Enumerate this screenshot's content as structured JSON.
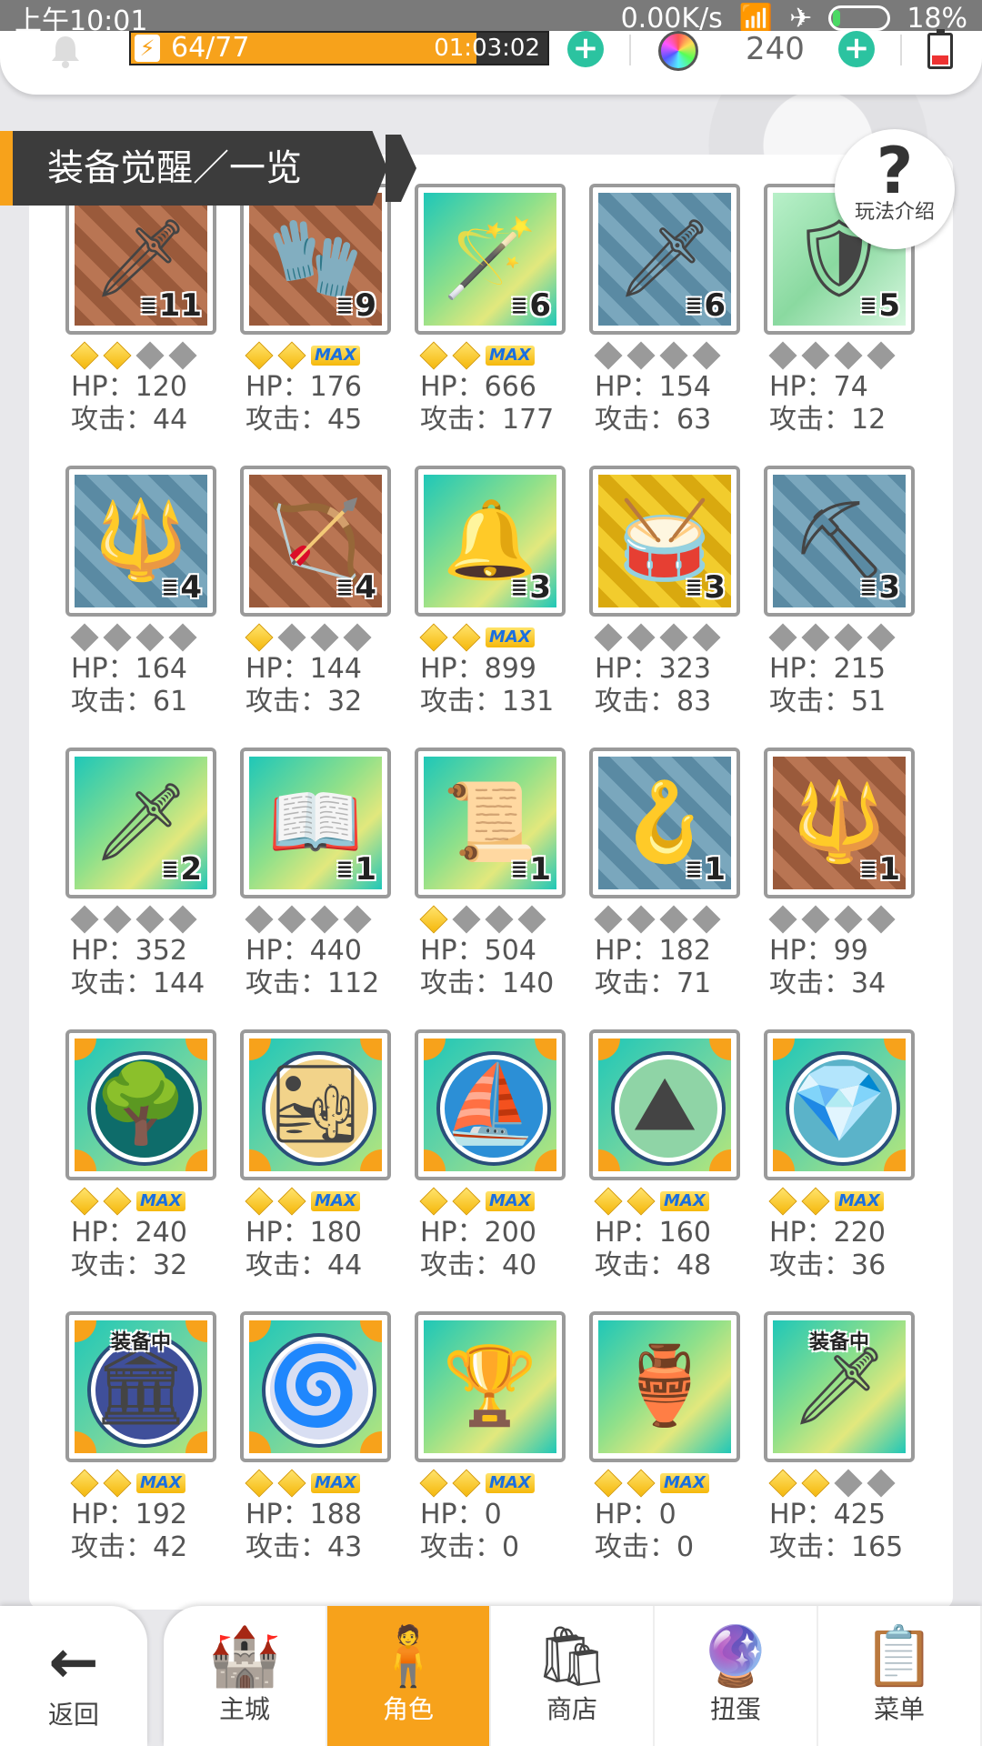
{
  "status_bar": {
    "time": "上午10:01",
    "speed": "0.00K/s",
    "battery": "18%"
  },
  "top_bar": {
    "stamina": "64/77",
    "stamina_fraction": 0.83,
    "timer": "01:03:02",
    "gems": "240"
  },
  "header": {
    "title": "装备觉醒／一览"
  },
  "help": {
    "label": "玩法介绍"
  },
  "stat_labels": {
    "hp": "HP：",
    "atk": "攻击："
  },
  "equipped_label": "装备中",
  "max_label": "MAX",
  "items": [
    {
      "icon": "sword-icon",
      "glyph": "🗡",
      "bg": "brown",
      "count": "11",
      "gold": 2,
      "max": false,
      "hp": "120",
      "atk": "44"
    },
    {
      "icon": "gauntlet-icon",
      "glyph": "🧤",
      "bg": "brown",
      "count": "9",
      "gold": 2,
      "max": true,
      "hp": "176",
      "atk": "45"
    },
    {
      "icon": "staff-icon",
      "glyph": "🪄",
      "bg": "rainbow",
      "count": "6",
      "gold": 2,
      "max": true,
      "hp": "666",
      "atk": "177"
    },
    {
      "icon": "blade-icon",
      "glyph": "🗡",
      "bg": "blue",
      "count": "6",
      "gold": 0,
      "max": false,
      "hp": "154",
      "atk": "63"
    },
    {
      "icon": "shield-icon",
      "glyph": "🛡",
      "bg": "green",
      "count": "5",
      "gold": 0,
      "max": false,
      "hp": "74",
      "atk": "12"
    },
    {
      "icon": "spear-icon",
      "glyph": "🔱",
      "bg": "blue",
      "count": "4",
      "gold": 0,
      "max": false,
      "hp": "164",
      "atk": "61"
    },
    {
      "icon": "bow-icon",
      "glyph": "🏹",
      "bg": "brown",
      "count": "4",
      "gold": 1,
      "max": false,
      "hp": "144",
      "atk": "32"
    },
    {
      "icon": "wreath-icon",
      "glyph": "🔔",
      "bg": "rainbow",
      "count": "3",
      "gold": 2,
      "max": true,
      "hp": "899",
      "atk": "131"
    },
    {
      "icon": "cannon-icon",
      "glyph": "🥁",
      "bg": "gold",
      "count": "3",
      "gold": 0,
      "max": false,
      "hp": "323",
      "atk": "83"
    },
    {
      "icon": "scythe-icon",
      "glyph": "⛏",
      "bg": "blue",
      "count": "3",
      "gold": 0,
      "max": false,
      "hp": "215",
      "atk": "51"
    },
    {
      "icon": "rainbow-sword-icon",
      "glyph": "🗡",
      "bg": "rainbow",
      "count": "2",
      "gold": 0,
      "max": false,
      "hp": "352",
      "atk": "144"
    },
    {
      "icon": "book-icon",
      "glyph": "📖",
      "bg": "rainbow",
      "count": "1",
      "gold": 0,
      "max": false,
      "hp": "440",
      "atk": "112"
    },
    {
      "icon": "scroll-icon",
      "glyph": "📜",
      "bg": "rainbow",
      "count": "1",
      "gold": 1,
      "max": false,
      "hp": "504",
      "atk": "140"
    },
    {
      "icon": "sickle-icon",
      "glyph": "🪝",
      "bg": "blue",
      "count": "1",
      "gold": 0,
      "max": false,
      "hp": "182",
      "atk": "71"
    },
    {
      "icon": "lance-icon",
      "glyph": "🔱",
      "bg": "brown",
      "count": "1",
      "gold": 0,
      "max": false,
      "hp": "99",
      "atk": "34"
    },
    {
      "icon": "forest-dome-icon",
      "glyph": "🌳",
      "bg": "scene",
      "dome": "#0e6c6a",
      "gold": 2,
      "max": true,
      "hp": "240",
      "atk": "32"
    },
    {
      "icon": "desert-dome-icon",
      "glyph": "🏜",
      "bg": "scene",
      "dome": "#f2d38a",
      "gold": 2,
      "max": true,
      "hp": "180",
      "atk": "44"
    },
    {
      "icon": "ocean-dome-icon",
      "glyph": "⛵",
      "bg": "scene",
      "dome": "#2c8fd6",
      "gold": 2,
      "max": true,
      "hp": "200",
      "atk": "40"
    },
    {
      "icon": "cliff-dome-icon",
      "glyph": "⛰",
      "bg": "scene",
      "dome": "#8fd4a6",
      "gold": 2,
      "max": true,
      "hp": "160",
      "atk": "48"
    },
    {
      "icon": "crystal-dome-icon",
      "glyph": "💎",
      "bg": "scene",
      "dome": "#5bb3c9",
      "gold": 2,
      "max": true,
      "hp": "220",
      "atk": "36"
    },
    {
      "icon": "night-dome-icon",
      "glyph": "🏛",
      "bg": "scene",
      "dome": "#3f4f9a",
      "gold": 2,
      "max": true,
      "equipped": true,
      "hp": "192",
      "atk": "42"
    },
    {
      "icon": "storm-dome-icon",
      "glyph": "🌀",
      "bg": "scene",
      "dome": "#d8def2",
      "gold": 2,
      "max": true,
      "hp": "188",
      "atk": "43"
    },
    {
      "icon": "trophy-icon",
      "glyph": "🏆",
      "bg": "rainbow",
      "gold": 2,
      "max": true,
      "hp": "0",
      "atk": "0"
    },
    {
      "icon": "pink-trophy-icon",
      "glyph": "🏺",
      "bg": "rainbow",
      "gold": 2,
      "max": true,
      "hp": "0",
      "atk": "0"
    },
    {
      "icon": "great-sword-icon",
      "glyph": "🗡",
      "bg": "rainbow",
      "gold": 2,
      "max": false,
      "equipped": true,
      "hp": "425",
      "atk": "165"
    }
  ],
  "nav": {
    "back": "返回",
    "tabs": [
      {
        "label": "主城",
        "icon": "castle-icon",
        "glyph": "🏰",
        "active": false
      },
      {
        "label": "角色",
        "icon": "character-icon",
        "glyph": "🧍",
        "active": true
      },
      {
        "label": "商店",
        "icon": "shop-icon",
        "glyph": "🛍",
        "active": false
      },
      {
        "label": "扭蛋",
        "icon": "gacha-icon",
        "glyph": "🔮",
        "active": false
      },
      {
        "label": "菜单",
        "icon": "menu-icon",
        "glyph": "📋",
        "active": false
      }
    ]
  }
}
